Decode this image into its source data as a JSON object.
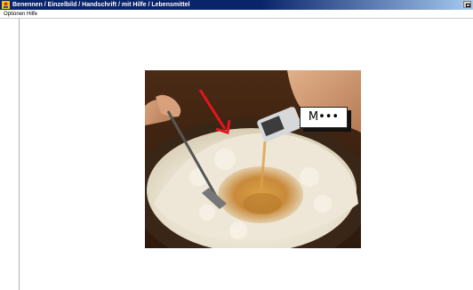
{
  "window": {
    "title": "Benennen / Einzelbild / Handschrift / mit Hilfe / Lebensmittel"
  },
  "menu": {
    "items": [
      {
        "label": "Optionen"
      },
      {
        "label": "Hilfe"
      }
    ]
  },
  "exercise": {
    "hint": "M•••",
    "colors": {
      "arrow": "#e8141e",
      "title_bar": "#0a246a"
    }
  }
}
